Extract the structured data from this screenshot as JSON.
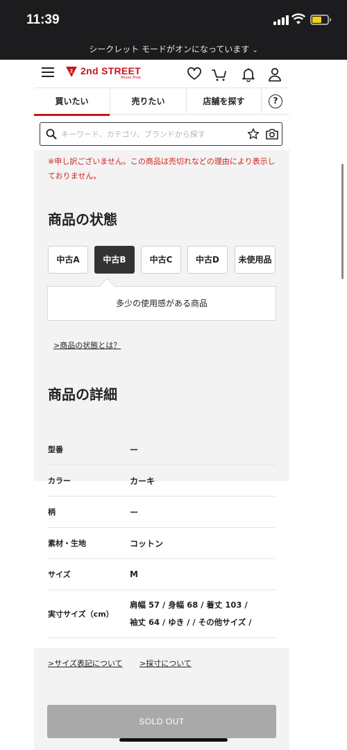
{
  "status_bar": {
    "time": "11:39"
  },
  "incognito_bar": {
    "text": "シークレット モードがオンになっています",
    "chevron": "⌄"
  },
  "header": {
    "brand": "2nd STREET",
    "brand_sub": "Reuse Shop"
  },
  "tabs": [
    {
      "label": "買いたい",
      "active": true
    },
    {
      "label": "売りたい",
      "active": false
    },
    {
      "label": "店舗を探す",
      "active": false
    }
  ],
  "help_label": "?",
  "search": {
    "placeholder": "キーワード、カテゴリ、ブランドから探す"
  },
  "notice": "※申し訳ございません。この商品は売切れなどの理由により表示しておりません。",
  "condition": {
    "title": "商品の状態",
    "options": [
      {
        "label": "中古A",
        "selected": false
      },
      {
        "label": "中古B",
        "selected": true
      },
      {
        "label": "中古C",
        "selected": false
      },
      {
        "label": "中古D",
        "selected": false
      },
      {
        "label": "未使用品",
        "selected": false
      }
    ],
    "description": "多少の使用感がある商品",
    "link": ">商品の状態とは？"
  },
  "details": {
    "title": "商品の詳細",
    "rows": [
      {
        "label": "型番",
        "value": "ー"
      },
      {
        "label": "カラー",
        "value": "カーキ"
      },
      {
        "label": "柄",
        "value": "ー"
      },
      {
        "label": "素材・生地",
        "value": "コットン"
      },
      {
        "label": "サイズ",
        "value": "M"
      },
      {
        "label": "実寸サイズ（cm）",
        "value_line1": "肩幅 57 / 身幅 68 / 着丈 103 /",
        "value_line2": "袖丈 64 / ゆき / / その他サイズ /"
      }
    ]
  },
  "size_links": {
    "notation": ">サイズ表記について",
    "measure": ">採寸について"
  },
  "sold_out_button": "SOLD OUT",
  "colors": {
    "brand_red": "#c8161d",
    "notice_red": "#d0201e",
    "selected_dark": "#333333",
    "button_gray": "#a9a9a9"
  }
}
